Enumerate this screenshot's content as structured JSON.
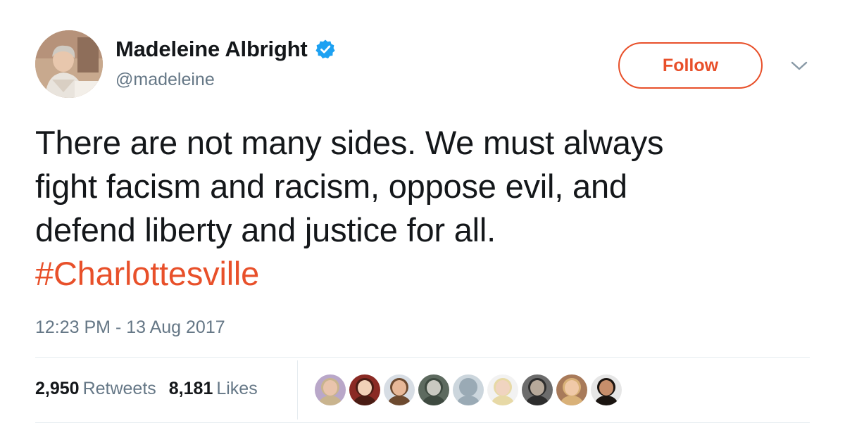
{
  "user": {
    "display_name": "Madeleine Albright",
    "handle": "@madeleine",
    "verified_icon": "verified-badge-icon"
  },
  "actions": {
    "follow_label": "Follow",
    "menu_icon": "chevron-down-icon"
  },
  "tweet": {
    "lines": [
      "There are not many sides. We must always",
      "fight facism and racism, oppose evil, and",
      "defend liberty and justice for all."
    ],
    "hashtag": "#Charlottesville",
    "timestamp": "12:23 PM - 13 Aug 2017"
  },
  "stats": {
    "retweets_count": "2,950",
    "retweets_label": "Retweets",
    "likes_count": "8,181",
    "likes_label": "Likes"
  },
  "likers": [
    {
      "name": "liker-avatar-1",
      "bg": "#b9a7c9",
      "skin": "#e9c4ac",
      "hair": "#c9b48e"
    },
    {
      "name": "liker-avatar-2",
      "bg": "#8a2a24",
      "skin": "#f1d1b8",
      "hair": "#4a1c14"
    },
    {
      "name": "liker-avatar-3",
      "bg": "#d7dde4",
      "skin": "#e7b898",
      "hair": "#6d4a2f"
    },
    {
      "name": "liker-avatar-4",
      "bg": "#5d6a5f",
      "skin": "#c9c9c1",
      "hair": "#3e4a40"
    },
    {
      "name": "liker-avatar-5",
      "bg": "#ccd6dd",
      "skin": "#9aaab5",
      "hair": "#9aaab5"
    },
    {
      "name": "liker-avatar-6",
      "bg": "#f2f2f2",
      "skin": "#f0d4c0",
      "hair": "#e7d9a6"
    },
    {
      "name": "liker-avatar-7",
      "bg": "#6c6c6c",
      "skin": "#b7a99a",
      "hair": "#2d2d2d"
    },
    {
      "name": "liker-avatar-8",
      "bg": "#a87a5a",
      "skin": "#f0c9a8",
      "hair": "#d9b178"
    },
    {
      "name": "liker-avatar-9",
      "bg": "#e6e6e6",
      "skin": "#c68e6b",
      "hair": "#1a1410"
    }
  ],
  "colors": {
    "accent": "#e8502a",
    "verified": "#1da1f2",
    "muted": "#657786",
    "text": "#14171a"
  }
}
